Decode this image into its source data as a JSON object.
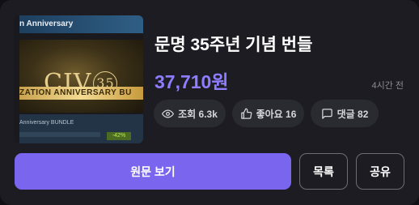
{
  "thumbnail": {
    "header_text": "n Anniversary",
    "logo_text": "CIV",
    "logo_number": "35",
    "banner_text": "ZATION ANNIVERSARY BU",
    "footer_text": "Anniversary BUNDLE",
    "discount_text": "-42%"
  },
  "deal": {
    "title": "문명 35주년 기념 번들",
    "price": "37,710원",
    "time_ago": "4시간 전"
  },
  "stats": {
    "views": "조회 6.3k",
    "likes": "좋아요 16",
    "comments": "댓글 82"
  },
  "actions": {
    "primary_label": "원문 보기",
    "list_label": "목록",
    "share_label": "공유"
  },
  "colors": {
    "background": "#1c1c22",
    "accent": "#7a66ee",
    "price": "#8f7dff",
    "chip": "#2a2a31"
  },
  "icons": {
    "views": "eye-icon",
    "likes": "thumbs-up-icon",
    "comments": "speech-bubble-icon"
  }
}
